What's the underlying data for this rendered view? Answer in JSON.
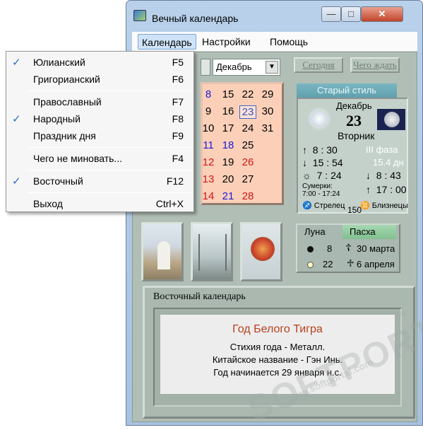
{
  "window": {
    "title": "Вечный календарь",
    "minimize_label": "—",
    "maximize_label": "□",
    "close_label": "✕"
  },
  "menubar": {
    "items": [
      "Календарь",
      "Настройки",
      "Помощь"
    ]
  },
  "dropdown": {
    "items": [
      {
        "label": "Юлианский",
        "shortcut": "F5",
        "checked": "✓"
      },
      {
        "label": "Григорианский",
        "shortcut": "F6",
        "checked": ""
      },
      {
        "label": "Православный",
        "shortcut": "F7",
        "checked": ""
      },
      {
        "label": "Народный",
        "shortcut": "F8",
        "checked": "✓"
      },
      {
        "label": "Праздник дня",
        "shortcut": "F9",
        "checked": ""
      },
      {
        "label": "Чего не миновать...",
        "shortcut": "F4",
        "checked": ""
      },
      {
        "label": "Восточный",
        "shortcut": "F12",
        "checked": "✓"
      },
      {
        "label": "Выход",
        "shortcut": "Ctrl+X",
        "checked": ""
      }
    ]
  },
  "toolbar": {
    "month_value": "Декабрь",
    "today_label": "Сегодня",
    "what_to_wait_label": "Чего ждать"
  },
  "calendar_grid": {
    "rows": [
      [
        "8",
        "15",
        "22",
        "29"
      ],
      [
        "9",
        "16",
        "23",
        "30"
      ],
      [
        "10",
        "17",
        "24",
        "31"
      ],
      [
        "11",
        "18",
        "25",
        ""
      ],
      [
        "12",
        "19",
        "26",
        ""
      ],
      [
        "13",
        "20",
        "27",
        ""
      ],
      [
        "14",
        "21",
        "28",
        ""
      ]
    ],
    "selected_day": "23",
    "colors": {
      "blue": "#1a1adc",
      "red": "#d01818",
      "normal": "#000000"
    }
  },
  "day_info": {
    "style_label": "Старый стиль",
    "month": "Декабрь",
    "day_number": "23",
    "weekday": "Вторник",
    "sunrise": "8 : 30",
    "moon_phase": "ІІІ фаза",
    "sunset": "15 : 54",
    "moon_age": "15.4 дн",
    "day_length": "7 : 24",
    "moonset": "8 : 43",
    "twilight_label": "Сумерки:",
    "twilight_value": "7:00 - 17:24",
    "moonrise": "17 : 00",
    "zodiac_sun": "Стрелец",
    "zodiac_moon": "Близнецы",
    "number": "150"
  },
  "luna": {
    "tab_luna": "Луна",
    "tab_pasha": "Пасха",
    "new_moon_day": "8",
    "full_moon_day": "22",
    "orthodox_easter": "30 марта",
    "catholic_easter": "6 апреля"
  },
  "eastern_calendar": {
    "header": "Восточный календарь",
    "year_title": "Год Белого Тигра",
    "element": "Стихия года - Металл.",
    "chinese_name": "Китайское название - Гэн Инь.",
    "year_start": "Год начинается 29 января н.с."
  },
  "watermark": {
    "text": "SOFTPORTAL",
    "url": "www.softportal.com",
    "tm": "TM"
  }
}
